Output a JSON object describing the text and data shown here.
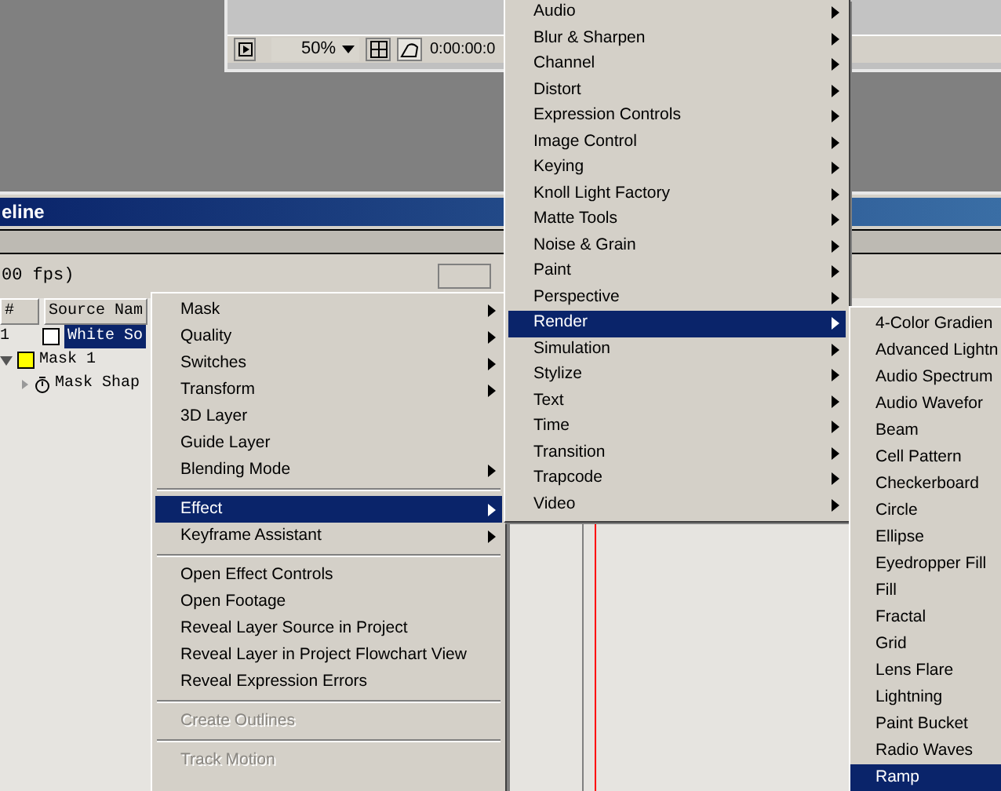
{
  "viewer": {
    "zoom": "50%",
    "timecode": "0:00:00:0"
  },
  "timeline": {
    "title": "eline",
    "frame_rate": "00 fps)",
    "columns": [
      "#",
      "Source Nam"
    ],
    "layers": [
      {
        "kind": "layer",
        "number": "1",
        "name": "White So",
        "color": "#ffffff",
        "selected": true
      },
      {
        "kind": "mask",
        "name": "Mask 1",
        "color": "#ffff00",
        "expanded": true
      },
      {
        "kind": "property",
        "name": "Mask Shap",
        "expanded": false
      }
    ]
  },
  "menus": [
    {
      "items": [
        {
          "kind": "item",
          "label": "Mask",
          "submenu": true,
          "selected": false,
          "disabled": false
        },
        {
          "kind": "item",
          "label": "Quality",
          "submenu": true,
          "selected": false,
          "disabled": false
        },
        {
          "kind": "item",
          "label": "Switches",
          "submenu": true,
          "selected": false,
          "disabled": false
        },
        {
          "kind": "item",
          "label": "Transform",
          "submenu": true,
          "selected": false,
          "disabled": false
        },
        {
          "kind": "item",
          "label": "3D Layer",
          "submenu": false,
          "selected": false,
          "disabled": false
        },
        {
          "kind": "item",
          "label": "Guide Layer",
          "submenu": false,
          "selected": false,
          "disabled": false
        },
        {
          "kind": "item",
          "label": "Blending Mode",
          "submenu": true,
          "selected": false,
          "disabled": false
        },
        {
          "kind": "separator"
        },
        {
          "kind": "item",
          "label": "Effect",
          "submenu": true,
          "selected": true,
          "disabled": false
        },
        {
          "kind": "item",
          "label": "Keyframe Assistant",
          "submenu": true,
          "selected": false,
          "disabled": false
        },
        {
          "kind": "separator"
        },
        {
          "kind": "item",
          "label": "Open Effect Controls",
          "submenu": false,
          "selected": false,
          "disabled": false
        },
        {
          "kind": "item",
          "label": "Open Footage",
          "submenu": false,
          "selected": false,
          "disabled": false
        },
        {
          "kind": "item",
          "label": "Reveal Layer Source in Project",
          "submenu": false,
          "selected": false,
          "disabled": false
        },
        {
          "kind": "item",
          "label": "Reveal Layer in Project Flowchart View",
          "submenu": false,
          "selected": false,
          "disabled": false
        },
        {
          "kind": "item",
          "label": "Reveal Expression Errors",
          "submenu": false,
          "selected": false,
          "disabled": false
        },
        {
          "kind": "separator"
        },
        {
          "kind": "item",
          "label": "Create Outlines",
          "submenu": false,
          "selected": false,
          "disabled": true
        },
        {
          "kind": "separator"
        },
        {
          "kind": "item",
          "label": "Track Motion",
          "submenu": false,
          "selected": false,
          "disabled": true
        }
      ]
    },
    {
      "items": [
        {
          "kind": "item",
          "label": "Audio",
          "submenu": true,
          "selected": false,
          "disabled": false
        },
        {
          "kind": "item",
          "label": "Blur & Sharpen",
          "submenu": true,
          "selected": false,
          "disabled": false
        },
        {
          "kind": "item",
          "label": "Channel",
          "submenu": true,
          "selected": false,
          "disabled": false
        },
        {
          "kind": "item",
          "label": "Distort",
          "submenu": true,
          "selected": false,
          "disabled": false
        },
        {
          "kind": "item",
          "label": "Expression Controls",
          "submenu": true,
          "selected": false,
          "disabled": false
        },
        {
          "kind": "item",
          "label": "Image Control",
          "submenu": true,
          "selected": false,
          "disabled": false
        },
        {
          "kind": "item",
          "label": "Keying",
          "submenu": true,
          "selected": false,
          "disabled": false
        },
        {
          "kind": "item",
          "label": "Knoll Light Factory",
          "submenu": true,
          "selected": false,
          "disabled": false
        },
        {
          "kind": "item",
          "label": "Matte Tools",
          "submenu": true,
          "selected": false,
          "disabled": false
        },
        {
          "kind": "item",
          "label": "Noise & Grain",
          "submenu": true,
          "selected": false,
          "disabled": false
        },
        {
          "kind": "item",
          "label": "Paint",
          "submenu": true,
          "selected": false,
          "disabled": false
        },
        {
          "kind": "item",
          "label": "Perspective",
          "submenu": true,
          "selected": false,
          "disabled": false
        },
        {
          "kind": "item",
          "label": "Render",
          "submenu": true,
          "selected": true,
          "disabled": false
        },
        {
          "kind": "item",
          "label": "Simulation",
          "submenu": true,
          "selected": false,
          "disabled": false
        },
        {
          "kind": "item",
          "label": "Stylize",
          "submenu": true,
          "selected": false,
          "disabled": false
        },
        {
          "kind": "item",
          "label": "Text",
          "submenu": true,
          "selected": false,
          "disabled": false
        },
        {
          "kind": "item",
          "label": "Time",
          "submenu": true,
          "selected": false,
          "disabled": false
        },
        {
          "kind": "item",
          "label": "Transition",
          "submenu": true,
          "selected": false,
          "disabled": false
        },
        {
          "kind": "item",
          "label": "Trapcode",
          "submenu": true,
          "selected": false,
          "disabled": false
        },
        {
          "kind": "item",
          "label": "Video",
          "submenu": true,
          "selected": false,
          "disabled": false
        }
      ]
    },
    {
      "items": [
        {
          "kind": "item",
          "label": "4-Color Gradien",
          "submenu": false,
          "selected": false,
          "disabled": false
        },
        {
          "kind": "item",
          "label": "Advanced Lightn",
          "submenu": false,
          "selected": false,
          "disabled": false
        },
        {
          "kind": "item",
          "label": "Audio Spectrum",
          "submenu": false,
          "selected": false,
          "disabled": false
        },
        {
          "kind": "item",
          "label": "Audio Wavefor",
          "submenu": false,
          "selected": false,
          "disabled": false
        },
        {
          "kind": "item",
          "label": "Beam",
          "submenu": false,
          "selected": false,
          "disabled": false
        },
        {
          "kind": "item",
          "label": "Cell Pattern",
          "submenu": false,
          "selected": false,
          "disabled": false
        },
        {
          "kind": "item",
          "label": "Checkerboard",
          "submenu": false,
          "selected": false,
          "disabled": false
        },
        {
          "kind": "item",
          "label": "Circle",
          "submenu": false,
          "selected": false,
          "disabled": false
        },
        {
          "kind": "item",
          "label": "Ellipse",
          "submenu": false,
          "selected": false,
          "disabled": false
        },
        {
          "kind": "item",
          "label": "Eyedropper Fill",
          "submenu": false,
          "selected": false,
          "disabled": false
        },
        {
          "kind": "item",
          "label": "Fill",
          "submenu": false,
          "selected": false,
          "disabled": false
        },
        {
          "kind": "item",
          "label": "Fractal",
          "submenu": false,
          "selected": false,
          "disabled": false
        },
        {
          "kind": "item",
          "label": "Grid",
          "submenu": false,
          "selected": false,
          "disabled": false
        },
        {
          "kind": "item",
          "label": "Lens Flare",
          "submenu": false,
          "selected": false,
          "disabled": false
        },
        {
          "kind": "item",
          "label": "Lightning",
          "submenu": false,
          "selected": false,
          "disabled": false
        },
        {
          "kind": "item",
          "label": "Paint Bucket",
          "submenu": false,
          "selected": false,
          "disabled": false
        },
        {
          "kind": "item",
          "label": "Radio Waves",
          "submenu": false,
          "selected": false,
          "disabled": false
        },
        {
          "kind": "item",
          "label": "Ramp",
          "submenu": false,
          "selected": true,
          "disabled": false
        }
      ]
    }
  ]
}
